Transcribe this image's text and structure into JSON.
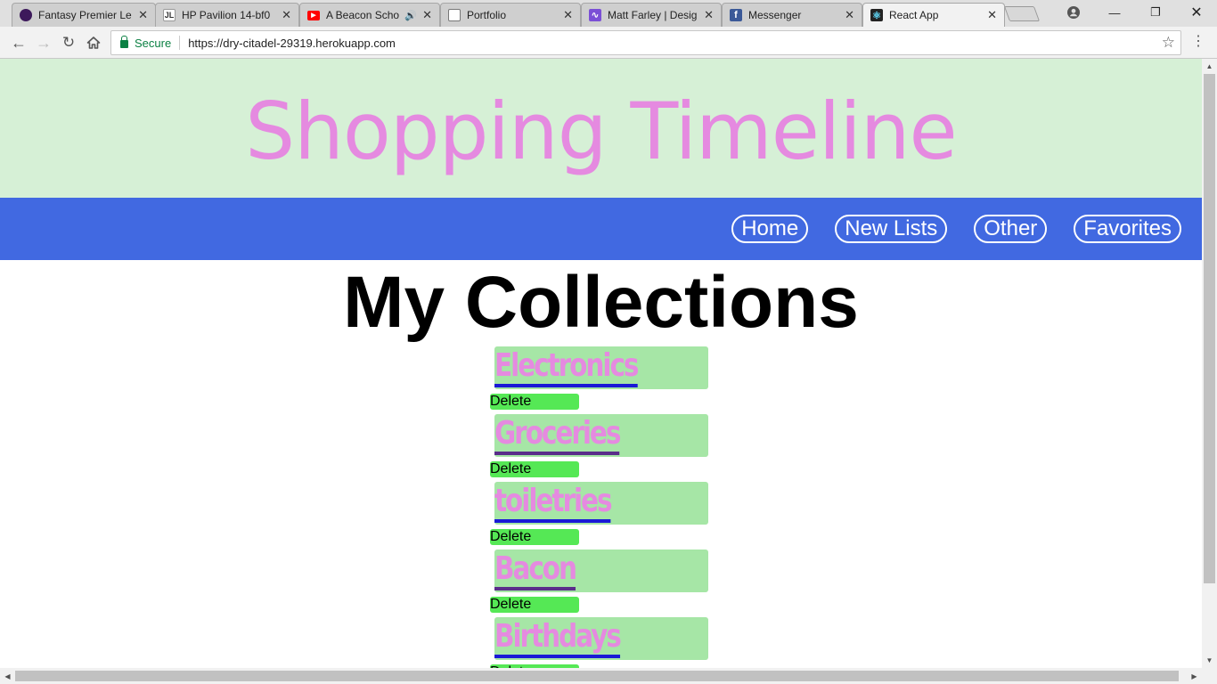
{
  "browser": {
    "tabs": [
      {
        "title": "Fantasy Premier Le",
        "icon": "premier-league-icon",
        "icon_color": "#3d195b",
        "active": false
      },
      {
        "title": "HP Pavilion 14-bf0",
        "icon": "jl-icon",
        "icon_color": "#ffffff",
        "active": false
      },
      {
        "title": "A Beacon Scho",
        "icon": "youtube-icon",
        "icon_color": "#ff0000",
        "active": false,
        "audio": true
      },
      {
        "title": "Portfolio",
        "icon": "page-icon",
        "icon_color": "#ffffff",
        "active": false
      },
      {
        "title": "Matt Farley | Desig",
        "icon": "chart-icon",
        "icon_color": "#7b4fd6",
        "active": false
      },
      {
        "title": "Messenger",
        "icon": "facebook-icon",
        "icon_color": "#3b5998",
        "active": false
      },
      {
        "title": "React App",
        "icon": "react-icon",
        "icon_color": "#222222",
        "active": true
      }
    ],
    "address": {
      "secure_label": "Secure",
      "url": "https://dry-citadel-29319.herokuapp.com"
    }
  },
  "page": {
    "header_title": "Shopping Timeline",
    "nav": [
      "Home",
      "New Lists",
      "Other",
      "Favorites"
    ],
    "heading": "My Collections",
    "collections": [
      {
        "name": "Electronics",
        "visited": false
      },
      {
        "name": "Groceries",
        "visited": true
      },
      {
        "name": "toiletries",
        "visited": false
      },
      {
        "name": "Bacon",
        "visited": true
      },
      {
        "name": "Birthdays",
        "visited": false
      }
    ],
    "delete_label": "Delete"
  },
  "colors": {
    "header_bg": "#d6f0d6",
    "title_color": "#e58ae0",
    "nav_bg": "#4169e1",
    "card_bg": "#a6e6a6",
    "delete_bg": "#55e855"
  }
}
